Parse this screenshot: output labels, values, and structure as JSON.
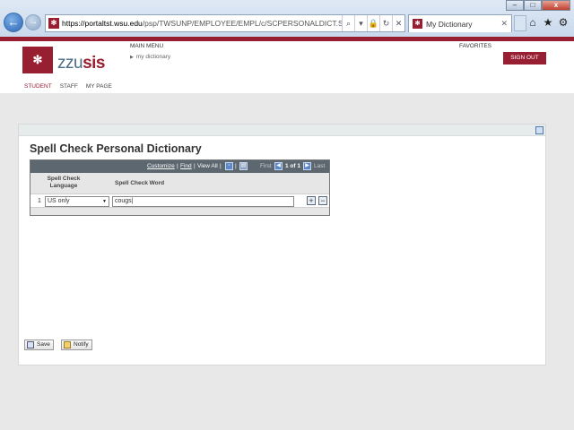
{
  "browser": {
    "url_host": "https://portaltst.wsu.edu",
    "url_path": "/psp/TWSUNP/EMPLOYEE/EMPL/c/SCPERSONALDICT.SCPERSONALI",
    "tab_title": "My Dictionary",
    "window_buttons": [
      "–",
      "□",
      "x"
    ],
    "back_symbol": "←",
    "forward_symbol": "→",
    "address_icons": [
      "⌕",
      "▾",
      "🔒",
      "↻",
      "✕"
    ],
    "tab_close": "✕",
    "tools": [
      "⌂",
      "★",
      "⚙"
    ]
  },
  "header": {
    "logo_text_prefix": "zzu",
    "logo_text_suffix": "sis",
    "main_menu": "MAIN MENU",
    "breadcrumb": "my dictionary",
    "favorites": "FAVORITES",
    "sign_out": "SIGN OUT",
    "nav": [
      "STUDENT",
      "STAFF",
      "MY PAGE"
    ]
  },
  "main": {
    "title": "Spell Check Personal Dictionary",
    "grid": {
      "toolbar": {
        "customize": "Customize",
        "find": "Find",
        "view_all": "View All",
        "first": "First",
        "range": "1 of 1",
        "last": "Last",
        "sep": "|"
      },
      "columns": [
        "Spell Check Language",
        "Spell Check Word"
      ],
      "rows": [
        {
          "num": "1",
          "language": "US only",
          "word": "cougs"
        }
      ]
    },
    "buttons": {
      "save": "Save",
      "notify": "Notify"
    }
  },
  "colors": {
    "brand": "#981e32",
    "grid_header": "#5d6770"
  }
}
